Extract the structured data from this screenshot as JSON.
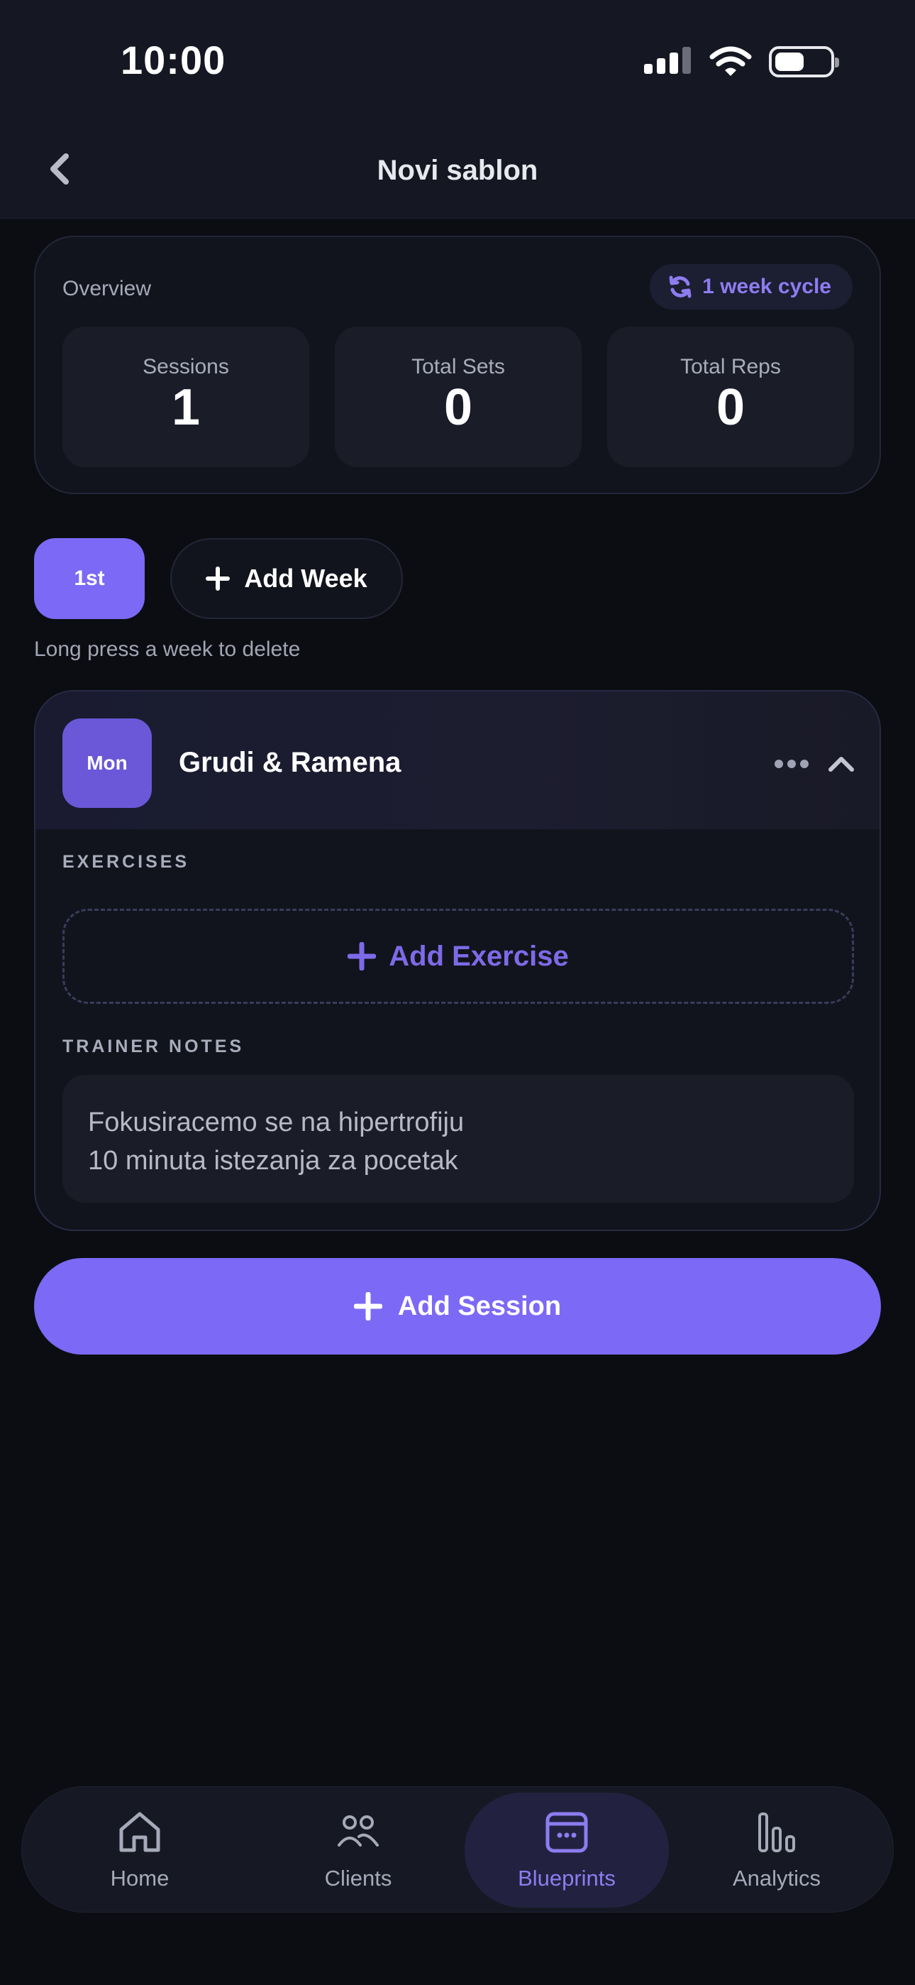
{
  "status_bar": {
    "time": "10:00"
  },
  "header": {
    "title": "Novi sablon"
  },
  "overview": {
    "label": "Overview",
    "cycle": "1 week cycle",
    "stats": [
      {
        "label": "Sessions",
        "value": "1"
      },
      {
        "label": "Total Sets",
        "value": "0"
      },
      {
        "label": "Total Reps",
        "value": "0"
      }
    ]
  },
  "weeks": {
    "items": [
      {
        "label": "1st"
      }
    ],
    "add_label": "Add Week",
    "hint": "Long press a week to delete"
  },
  "session": {
    "day": "Mon",
    "name": "Grudi & Ramena",
    "exercises_label": "EXERCISES",
    "add_exercise_label": "Add Exercise",
    "notes_label": "TRAINER NOTES",
    "notes_lines": [
      "Fokusiracemo se na hipertrofiju",
      "10 minuta istezanja za pocetak"
    ]
  },
  "add_session_label": "Add Session",
  "nav": {
    "items": [
      {
        "label": "Home",
        "icon": "home-icon"
      },
      {
        "label": "Clients",
        "icon": "users-icon"
      },
      {
        "label": "Blueprints",
        "icon": "calendar-icon",
        "active": true
      },
      {
        "label": "Analytics",
        "icon": "bar-chart-icon"
      }
    ]
  },
  "colors": {
    "accent": "#7c69f5",
    "accent_text": "#8e7cf0",
    "background": "#0c0d12",
    "card": "#12141d"
  }
}
